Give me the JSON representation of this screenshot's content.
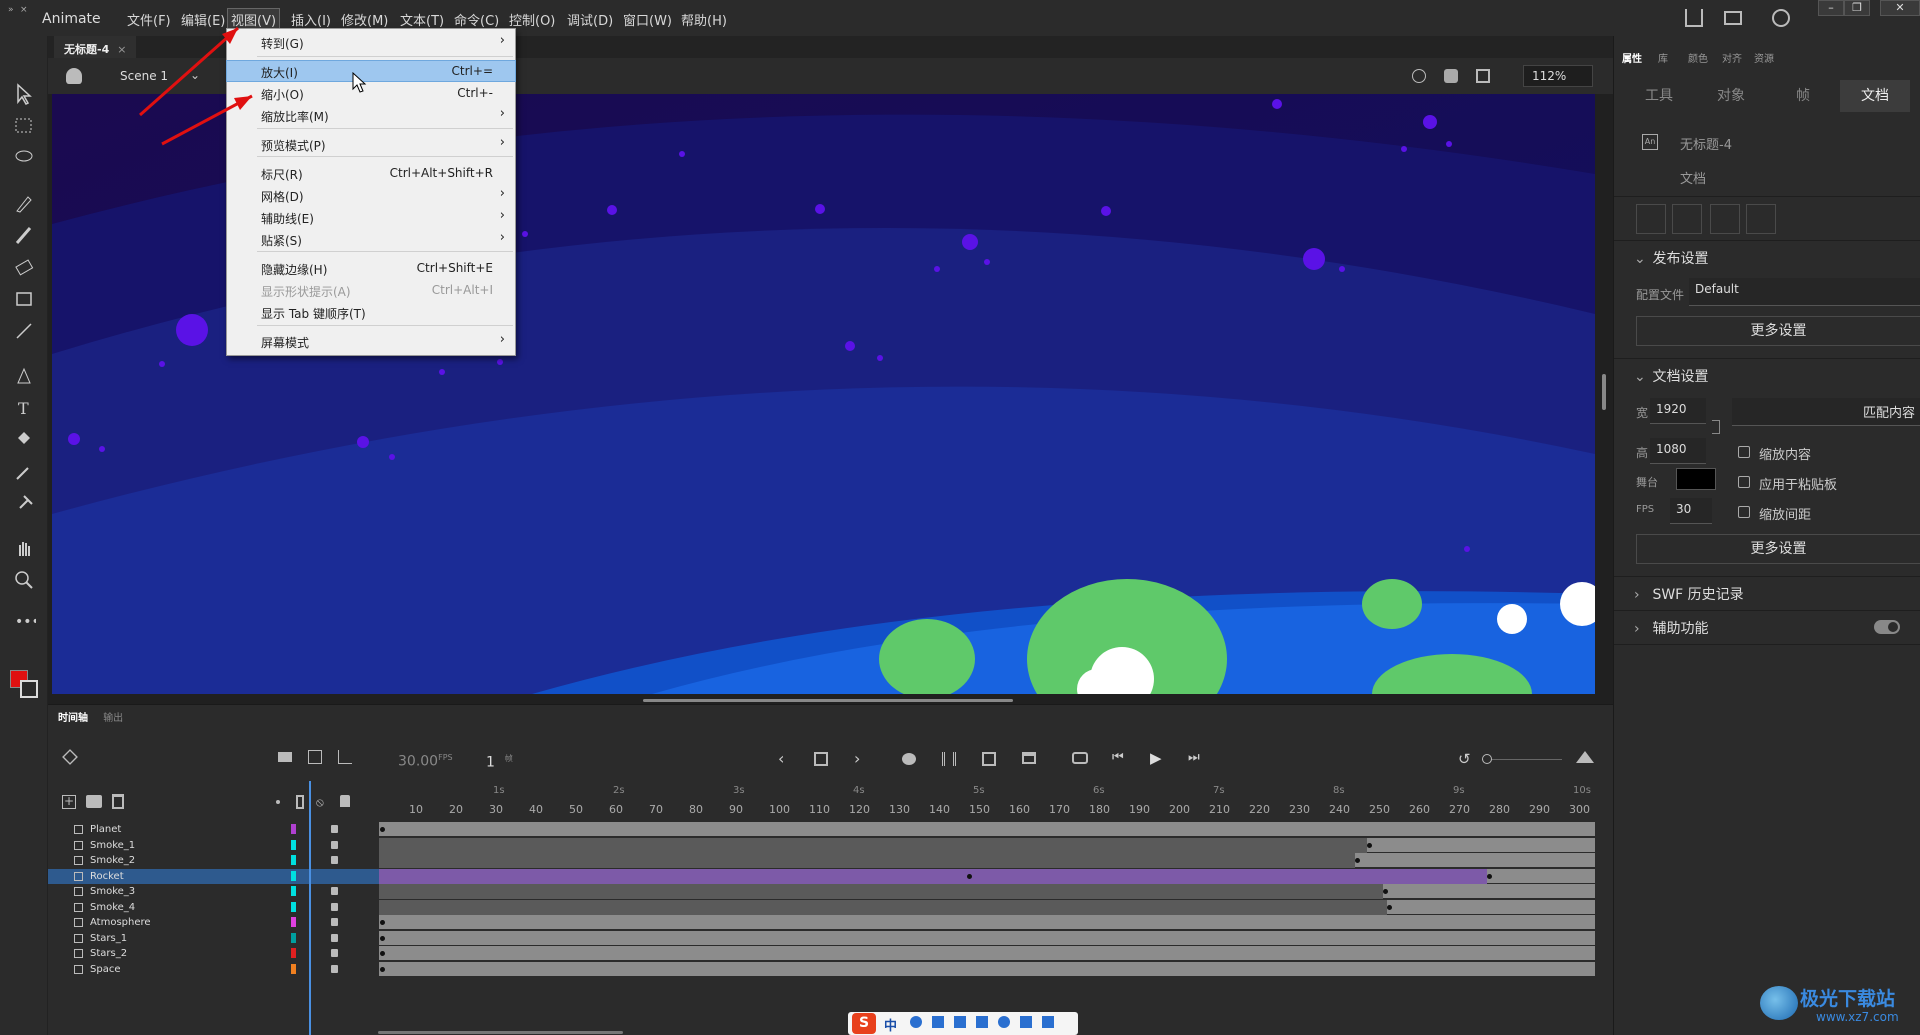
{
  "app": {
    "name": "Animate",
    "menus": [
      "文件(F)",
      "编辑(E)",
      "视图(V)",
      "插入(I)",
      "修改(M)",
      "文本(T)",
      "命令(C)",
      "控制(O)",
      "调试(D)",
      "窗口(W)",
      "帮助(H)"
    ]
  },
  "document": {
    "tab_title": "无标题-4",
    "tab_close": "×",
    "scene": "Scene 1",
    "zoom": "112%"
  },
  "view_menu": {
    "items": [
      {
        "label": "转到(G)",
        "shortcut": "",
        "submenu": true
      },
      {
        "label": "放大(I)",
        "shortcut": "Ctrl+=",
        "submenu": false
      },
      {
        "label": "缩小(O)",
        "shortcut": "Ctrl+-",
        "submenu": false
      },
      {
        "label": "缩放比率(M)",
        "shortcut": "",
        "submenu": true
      },
      {
        "label": "预览模式(P)",
        "shortcut": "",
        "submenu": true
      },
      {
        "label": "标尺(R)",
        "shortcut": "Ctrl+Alt+Shift+R",
        "submenu": false
      },
      {
        "label": "网格(D)",
        "shortcut": "",
        "submenu": true
      },
      {
        "label": "辅助线(E)",
        "shortcut": "",
        "submenu": true
      },
      {
        "label": "贴紧(S)",
        "shortcut": "",
        "submenu": true
      },
      {
        "label": "隐藏边缘(H)",
        "shortcut": "Ctrl+Shift+E",
        "submenu": false
      },
      {
        "label": "显示形状提示(A)",
        "shortcut": "Ctrl+Alt+I",
        "submenu": false
      },
      {
        "label": "显示 Tab 键顺序(T)",
        "shortcut": "",
        "submenu": false
      },
      {
        "label": "屏幕模式",
        "shortcut": "",
        "submenu": true
      }
    ],
    "highlighted": "放大(I)",
    "disabled": "显示形状提示(A)"
  },
  "right_panel": {
    "tabs": [
      "属性",
      "库",
      "颜色",
      "对齐",
      "资源"
    ],
    "subtabs": [
      "工具",
      "对象",
      "帧",
      "文档"
    ],
    "doc_name": "无标题-4",
    "doc_type": "文档",
    "publish": {
      "title": "发布设置",
      "profile_label": "配置文件",
      "profile_value": "Default",
      "more_button": "更多设置"
    },
    "doc_settings": {
      "title": "文档设置",
      "width_label": "宽",
      "width_value": "1920",
      "height_label": "高",
      "height_value": "1080",
      "stage_label": "舞台",
      "fps_label": "FPS",
      "fps_value": "30",
      "match_button": "匹配内容",
      "scale_content": "缩放内容",
      "apply_to_pasteboard": "应用于粘贴板",
      "scale_spacing": "缩放间距",
      "more_button": "更多设置",
      "stage_color": "#000000"
    },
    "swf_history": "SWF 历史记录",
    "accessibility": "辅助功能"
  },
  "timeline": {
    "tabs": [
      "时间轴",
      "输出"
    ],
    "fps": "30.00",
    "fps_unit": "FPS",
    "frame": "1",
    "frame_unit": "帧",
    "ruler_numbers": [
      "10",
      "20",
      "30",
      "40",
      "50",
      "60",
      "70",
      "80",
      "90",
      "100",
      "110",
      "120",
      "130",
      "140",
      "150",
      "160",
      "170",
      "180",
      "190",
      "200",
      "210",
      "220",
      "230",
      "240",
      "250",
      "260",
      "270",
      "280",
      "290",
      "300"
    ],
    "seconds": [
      "1s",
      "2s",
      "3s",
      "4s",
      "5s",
      "6s",
      "7s",
      "8s",
      "9s",
      "10s"
    ],
    "layers": [
      {
        "name": "Planet",
        "color": "#b040d0",
        "locked": true,
        "tween_end": 0,
        "purple": false
      },
      {
        "name": "Smoke_1",
        "color": "#00e0e0",
        "locked": true,
        "tween_end": 247,
        "purple": false
      },
      {
        "name": "Smoke_2",
        "color": "#00e0e0",
        "locked": true,
        "tween_end": 244,
        "purple": false
      },
      {
        "name": "Rocket",
        "color": "#00e0e0",
        "locked": false,
        "tween_end": 277,
        "purple": true
      },
      {
        "name": "Smoke_3",
        "color": "#00e0e0",
        "locked": true,
        "tween_end": 251,
        "purple": false
      },
      {
        "name": "Smoke_4",
        "color": "#00e0e0",
        "locked": true,
        "tween_end": 252,
        "purple": false
      },
      {
        "name": "Atmosphere",
        "color": "#e040e0",
        "locked": true,
        "tween_end": 0,
        "purple": false
      },
      {
        "name": "Stars_1",
        "color": "#00a0a0",
        "locked": true,
        "tween_end": 0,
        "purple": false
      },
      {
        "name": "Stars_2",
        "color": "#e02020",
        "locked": true,
        "tween_end": 0,
        "purple": false
      },
      {
        "name": "Space",
        "color": "#f08020",
        "locked": true,
        "tween_end": 0,
        "purple": false
      }
    ]
  },
  "ime": {
    "label": "中"
  },
  "watermark": {
    "line1": "极光下载站",
    "line2": "www.xz7.com"
  }
}
